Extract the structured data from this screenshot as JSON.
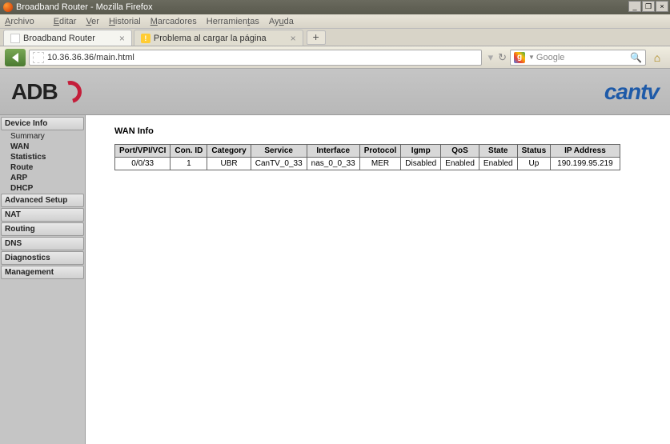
{
  "window": {
    "title": "Broadband Router - Mozilla Firefox"
  },
  "menubar": [
    "Archivo",
    "Editar",
    "Ver",
    "Historial",
    "Marcadores",
    "Herramientas",
    "Ayuda"
  ],
  "tabs": [
    {
      "label": "Broadband Router",
      "active": true
    },
    {
      "label": "Problema al cargar la página",
      "active": false,
      "warn": true
    }
  ],
  "navbar": {
    "url": "10.36.36.36/main.html",
    "search_placeholder": "Google"
  },
  "banner": {
    "left_logo": "ADB",
    "right_logo": "cantv"
  },
  "sidebar": [
    {
      "label": "Device Info",
      "type": "header"
    },
    {
      "label": "Summary",
      "type": "sub"
    },
    {
      "label": "WAN",
      "type": "sub",
      "bold": true
    },
    {
      "label": "Statistics",
      "type": "sub",
      "bold": true
    },
    {
      "label": "Route",
      "type": "sub",
      "bold": true
    },
    {
      "label": "ARP",
      "type": "sub",
      "bold": true
    },
    {
      "label": "DHCP",
      "type": "sub",
      "bold": true
    },
    {
      "label": "Advanced Setup",
      "type": "header"
    },
    {
      "label": "NAT",
      "type": "header"
    },
    {
      "label": "Routing",
      "type": "header"
    },
    {
      "label": "DNS",
      "type": "header"
    },
    {
      "label": "Diagnostics",
      "type": "header"
    },
    {
      "label": "Management",
      "type": "header"
    }
  ],
  "content": {
    "heading": "WAN Info",
    "columns": [
      "Port/VPI/VCI",
      "Con. ID",
      "Category",
      "Service",
      "Interface",
      "Protocol",
      "Igmp",
      "QoS",
      "State",
      "Status",
      "IP Address"
    ],
    "rows": [
      [
        "0/0/33",
        "1",
        "UBR",
        "CanTV_0_33",
        "nas_0_0_33",
        "MER",
        "Disabled",
        "Enabled",
        "Enabled",
        "Up",
        "190.199.95.219"
      ]
    ]
  }
}
